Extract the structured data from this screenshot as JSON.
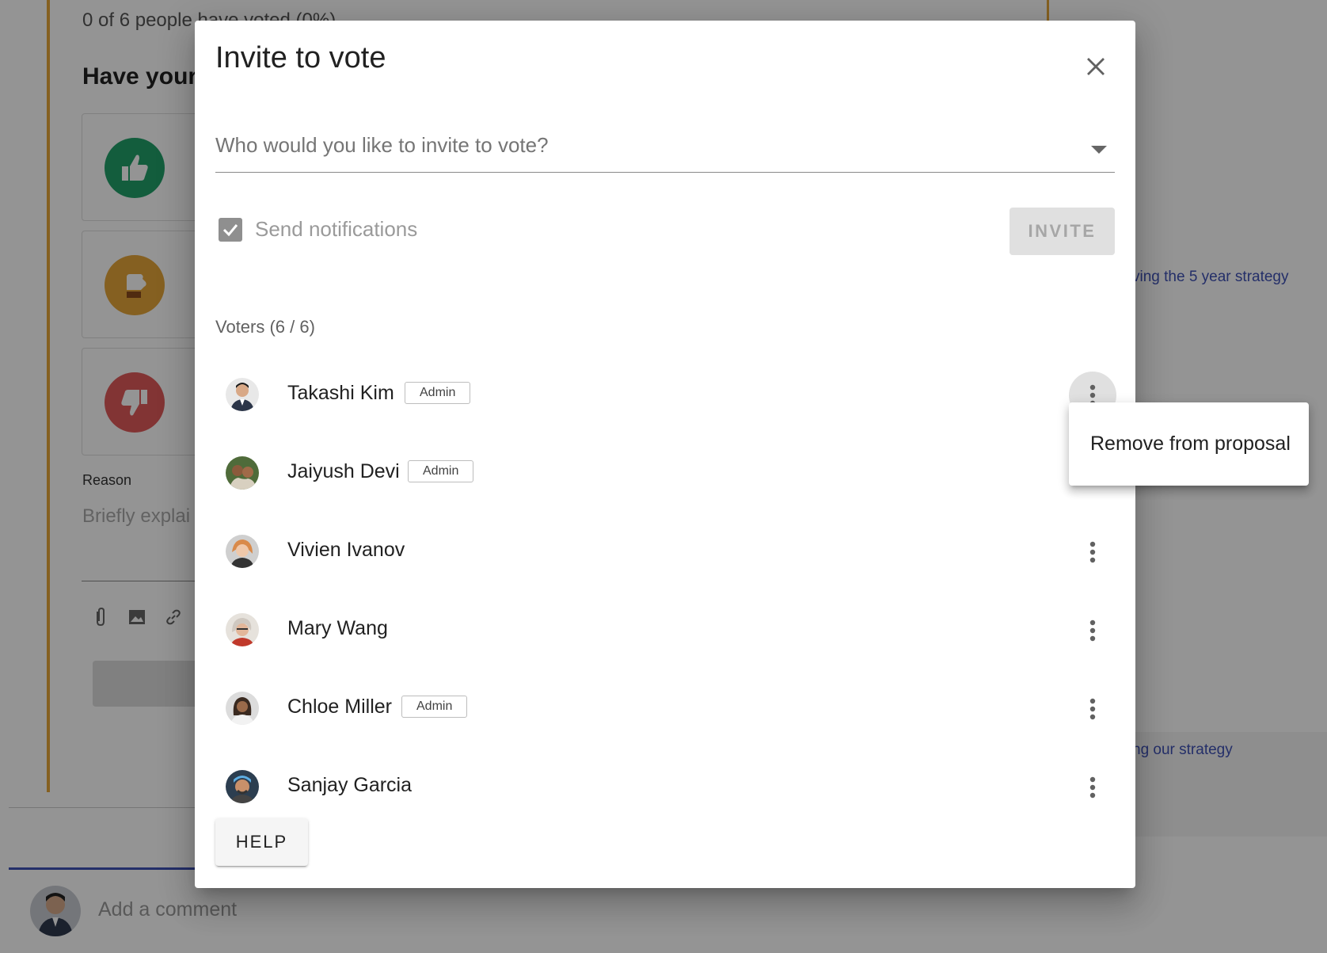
{
  "background": {
    "vote_status": "0 of 6 people have voted (0%)",
    "have_your_say": "Have your",
    "reason_label": "Reason",
    "reason_placeholder": "Briefly explai",
    "side_links": [
      "ving the 5 year strategy",
      "ng our strategy"
    ],
    "comment_placeholder": "Add a comment",
    "accent_color": "#e5a63a"
  },
  "dialog": {
    "title": "Invite to vote",
    "invite_placeholder": "Who would you like to invite to vote?",
    "send_notifications_label": "Send notifications",
    "send_notifications_checked": true,
    "invite_button": "INVITE",
    "voters_heading": "Voters (6 / 6)",
    "voters": [
      {
        "name": "Takashi Kim",
        "badge": "Admin"
      },
      {
        "name": "Jaiyush Devi",
        "badge": "Admin"
      },
      {
        "name": "Vivien Ivanov",
        "badge": ""
      },
      {
        "name": "Mary Wang",
        "badge": ""
      },
      {
        "name": "Chloe Miller",
        "badge": "Admin"
      },
      {
        "name": "Sanjay Garcia",
        "badge": ""
      }
    ],
    "help_button": "HELP"
  },
  "menu": {
    "items": [
      "Remove from proposal"
    ]
  },
  "colors": {
    "primary": "#3f51b5",
    "agree": "#21a06a",
    "abstain": "#e5a63a",
    "disagree": "#e05a5a"
  }
}
